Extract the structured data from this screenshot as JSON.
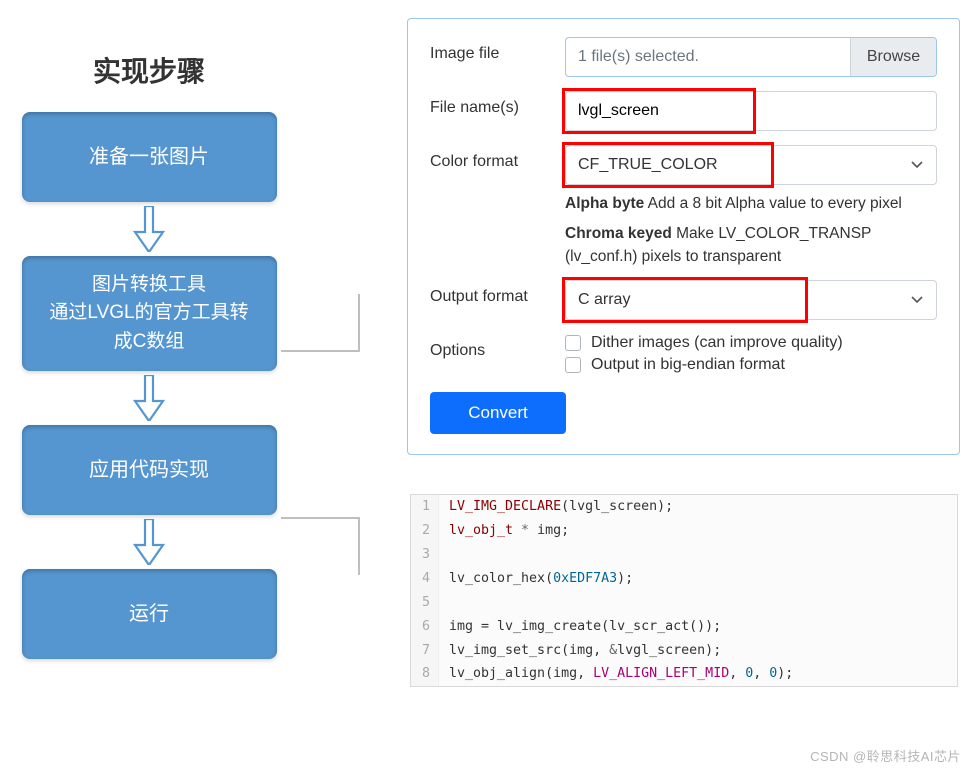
{
  "flow": {
    "title": "实现步骤",
    "steps": [
      "准备一张图片",
      "图片转换工具\n通过LVGL的官方工具转\n成C数组",
      "应用代码实现",
      "运行"
    ]
  },
  "form": {
    "imageFile": {
      "label": "Image file",
      "text": "1 file(s) selected.",
      "browse": "Browse"
    },
    "fileName": {
      "label": "File name(s)",
      "value": "lvgl_screen"
    },
    "colorFormat": {
      "label": "Color format",
      "value": "CF_TRUE_COLOR",
      "helperAlphaBold": "Alpha byte",
      "helperAlphaRest": " Add a 8 bit Alpha value to every pixel",
      "helperChromaBold": "Chroma keyed",
      "helperChromaRest": " Make LV_COLOR_TRANSP (lv_conf.h) pixels to transparent"
    },
    "outputFormat": {
      "label": "Output format",
      "value": "C array"
    },
    "options": {
      "label": "Options",
      "dither": "Dither images (can improve quality)",
      "bigEndian": "Output in big-endian format"
    },
    "convert": "Convert"
  },
  "code": {
    "lines": {
      "l1": {
        "n": "1",
        "a": "LV_IMG_DECLARE",
        "b": "(lvgl_screen);"
      },
      "l2": {
        "n": "2",
        "a": "lv_obj_t",
        "b": " * ",
        "c": "img;"
      },
      "l3": {
        "n": "3",
        "a": ""
      },
      "l4": {
        "n": "4",
        "a": "lv_color_hex(",
        "b": "0xEDF7A3",
        "c": ");"
      },
      "l5": {
        "n": "5",
        "a": ""
      },
      "l6": {
        "n": "6",
        "a": "img = lv_img_create(lv_scr_act());"
      },
      "l7": {
        "n": "7",
        "a": "lv_img_set_src(img, ",
        "b": "&",
        "c": "lvgl_screen);"
      },
      "l8": {
        "n": "8",
        "a": "lv_obj_align(img, ",
        "b": "LV_ALIGN_LEFT_MID",
        "c": ", ",
        "d": "0",
        "e": ", ",
        "f": "0",
        "g": ");"
      }
    }
  },
  "watermark": "CSDN @聆思科技AI芯片"
}
